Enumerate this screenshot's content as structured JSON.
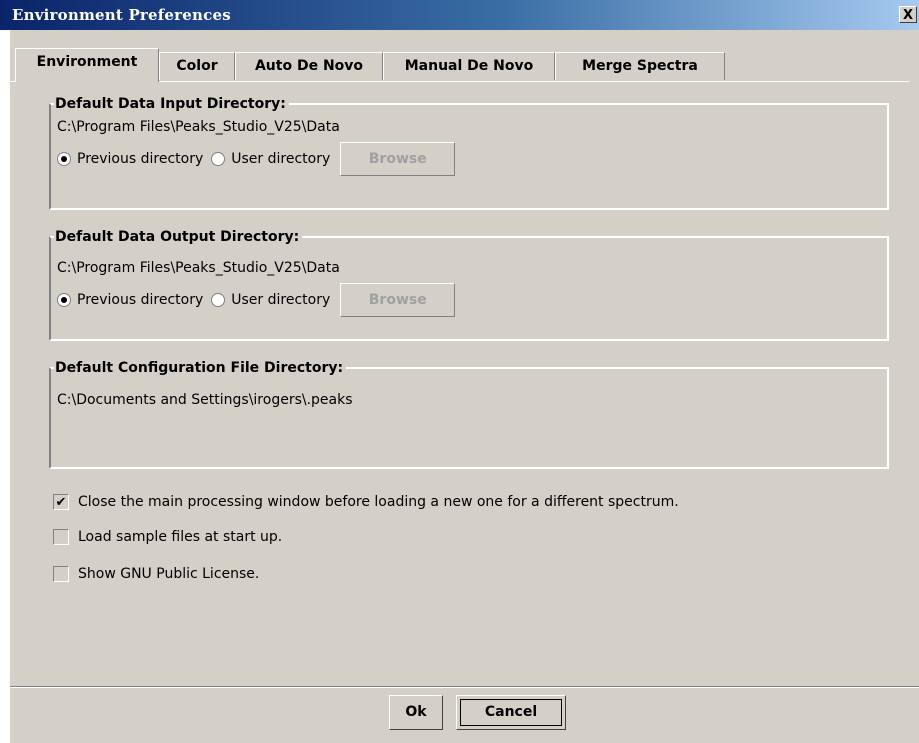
{
  "window": {
    "title": "Environment Preferences",
    "close_label": "X"
  },
  "tabs": [
    {
      "label": "Environment",
      "active": true
    },
    {
      "label": "Color",
      "active": false
    },
    {
      "label": "Auto De Novo",
      "active": false
    },
    {
      "label": "Manual De Novo",
      "active": false
    },
    {
      "label": "Merge Spectra",
      "active": false
    }
  ],
  "input_dir": {
    "title": "Default Data Input Directory:",
    "path": "C:\\Program Files\\Peaks_Studio_V25\\Data",
    "radio_previous": "Previous directory",
    "radio_user": "User directory",
    "selected": "previous",
    "browse_label": "Browse"
  },
  "output_dir": {
    "title": "Default Data Output Directory:",
    "path": "C:\\Program Files\\Peaks_Studio_V25\\Data",
    "radio_previous": "Previous directory",
    "radio_user": "User directory",
    "selected": "previous",
    "browse_label": "Browse"
  },
  "config_dir": {
    "title": "Default Configuration File Directory:",
    "path": "C:\\Documents and Settings\\irogers\\.peaks"
  },
  "options": [
    {
      "label": "Close the main processing window before loading a new one for a different spectrum.",
      "checked": true
    },
    {
      "label": "Load sample files at start up.",
      "checked": false
    },
    {
      "label": "Show GNU Public License.",
      "checked": false
    }
  ],
  "buttons": {
    "ok": "Ok",
    "cancel": "Cancel"
  },
  "colors": {
    "titlebar_start": "#0a246a",
    "titlebar_end": "#a6caf0",
    "panel_bg": "#d4d0c8",
    "disabled_text": "#a0a0a0"
  }
}
